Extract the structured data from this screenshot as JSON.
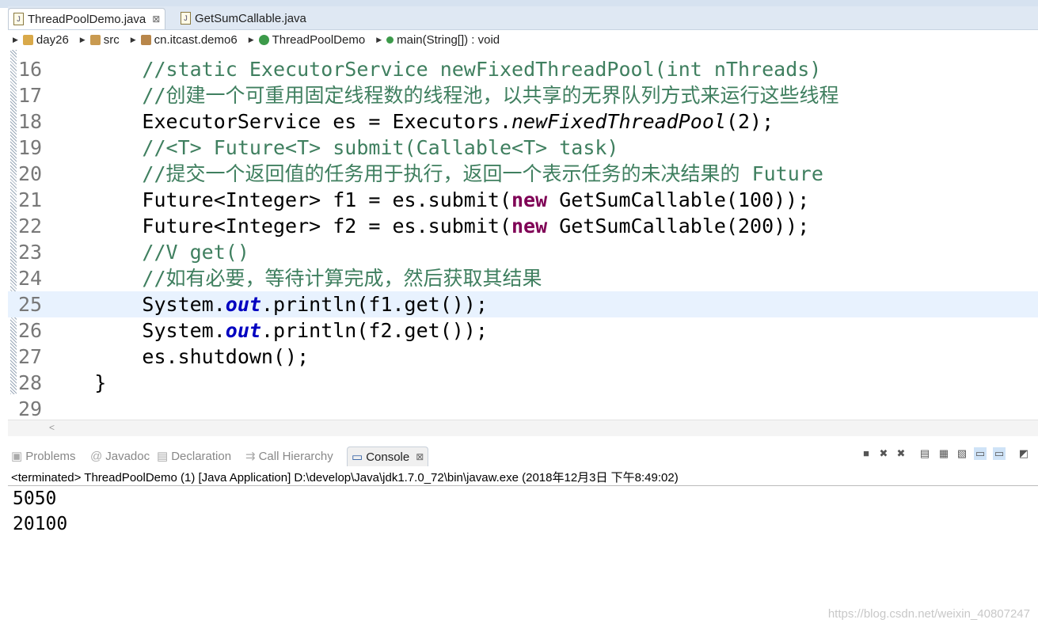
{
  "tabs": [
    {
      "label": "ThreadPoolDemo.java",
      "active": true,
      "close": "⊠"
    },
    {
      "label": "GetSumCallable.java",
      "active": false
    }
  ],
  "breadcrumb": [
    "day26",
    "src",
    "cn.itcast.demo6",
    "ThreadPoolDemo",
    "main(String[]) : void"
  ],
  "code": {
    "current_line": "25",
    "lines": [
      {
        "n": "16",
        "segs": [
          [
            "        ",
            "n"
          ],
          [
            "//static ExecutorService newFixedThreadPool(int nThreads)",
            "c"
          ]
        ]
      },
      {
        "n": "17",
        "segs": [
          [
            "        ",
            "n"
          ],
          [
            "//创建一个可重用固定线程数的线程池，以共享的无界队列方式来运行这些线程",
            "c"
          ]
        ]
      },
      {
        "n": "18",
        "segs": [
          [
            "        ExecutorService es = Executors.",
            "n"
          ],
          [
            "newFixedThreadPool",
            "m"
          ],
          [
            "(2);",
            "n"
          ]
        ]
      },
      {
        "n": "19",
        "segs": [
          [
            "        ",
            "n"
          ],
          [
            "//<T> Future<T> submit(Callable<T> task)",
            "c"
          ]
        ]
      },
      {
        "n": "20",
        "segs": [
          [
            "        ",
            "n"
          ],
          [
            "//提交一个返回值的任务用于执行，返回一个表示任务的未决结果的 Future",
            "c"
          ]
        ]
      },
      {
        "n": "21",
        "segs": [
          [
            "        Future<Integer> f1 = es.submit(",
            "n"
          ],
          [
            "new",
            "k"
          ],
          [
            " GetSumCallable(100));",
            "n"
          ]
        ]
      },
      {
        "n": "22",
        "segs": [
          [
            "        Future<Integer> f2 = es.submit(",
            "n"
          ],
          [
            "new",
            "k"
          ],
          [
            " GetSumCallable(200));",
            "n"
          ]
        ]
      },
      {
        "n": "23",
        "segs": [
          [
            "        ",
            "n"
          ],
          [
            "//V get()",
            "c"
          ]
        ]
      },
      {
        "n": "24",
        "segs": [
          [
            "        ",
            "n"
          ],
          [
            "//如有必要，等待计算完成，然后获取其结果",
            "c"
          ]
        ]
      },
      {
        "n": "25",
        "segs": [
          [
            "        System.",
            "n"
          ],
          [
            "out",
            "f"
          ],
          [
            ".println(f1.get());",
            "n"
          ]
        ]
      },
      {
        "n": "26",
        "segs": [
          [
            "        System.",
            "n"
          ],
          [
            "out",
            "f"
          ],
          [
            ".println(f2.get());",
            "n"
          ]
        ]
      },
      {
        "n": "27",
        "segs": [
          [
            "        es.shutdown();",
            "n"
          ]
        ]
      },
      {
        "n": "28",
        "segs": [
          [
            "    }",
            "n"
          ]
        ]
      },
      {
        "n": "29",
        "segs": [
          [
            "",
            "n"
          ]
        ]
      }
    ]
  },
  "console": {
    "tabs": [
      {
        "label": "Problems",
        "icon": "problems-icon"
      },
      {
        "label": "Javadoc",
        "icon": "@"
      },
      {
        "label": "Declaration",
        "icon": "declaration-icon"
      },
      {
        "label": "Call Hierarchy",
        "icon": "call-hierarchy-icon"
      },
      {
        "label": "Console",
        "icon": "console-icon",
        "active": true,
        "close": "⊠"
      }
    ],
    "status": "<terminated> ThreadPoolDemo (1) [Java Application] D:\\develop\\Java\\jdk1.7.0_72\\bin\\javaw.exe (2018年12月3日 下午8:49:02)",
    "output": [
      "5050",
      "20100"
    ]
  },
  "watermark": "https://blog.csdn.net/weixin_40807247"
}
